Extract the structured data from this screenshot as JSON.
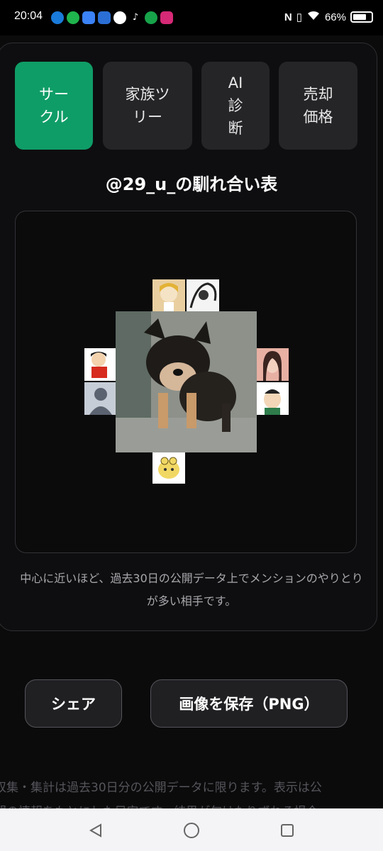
{
  "status": {
    "time": "20:04",
    "battery": "66%",
    "apps": [
      "#1a7ad9",
      "#1fb44d",
      "#3b82f6",
      "#2b6fd6",
      "#ffffff",
      "#000000",
      "#17a34a",
      "#d62976"
    ]
  },
  "tabs": [
    {
      "label": "サー\nクル",
      "active": true
    },
    {
      "label": "家族ツ\nリー",
      "active": false
    },
    {
      "label": "AI\n診\n断",
      "active": false
    },
    {
      "label": "売却\n価格",
      "active": false
    }
  ],
  "title": "@29_u_の馴れ合い表",
  "note": "中心に近いほど、過去30日の公開データ上でメンションのやりとりが多い相手です。",
  "buttons": {
    "share": "シェア",
    "save": "画像を保存（PNG）"
  },
  "footer": {
    "line1": "収集・集計は過去30日分の公開データに限ります。表示は公",
    "line2": "開の情報をもとにした目安です。結果が匂はたりずれる場合"
  },
  "colors": {
    "accent": "#0f9d67",
    "tab_bg": "#252528",
    "bg": "#0b0b0c"
  }
}
